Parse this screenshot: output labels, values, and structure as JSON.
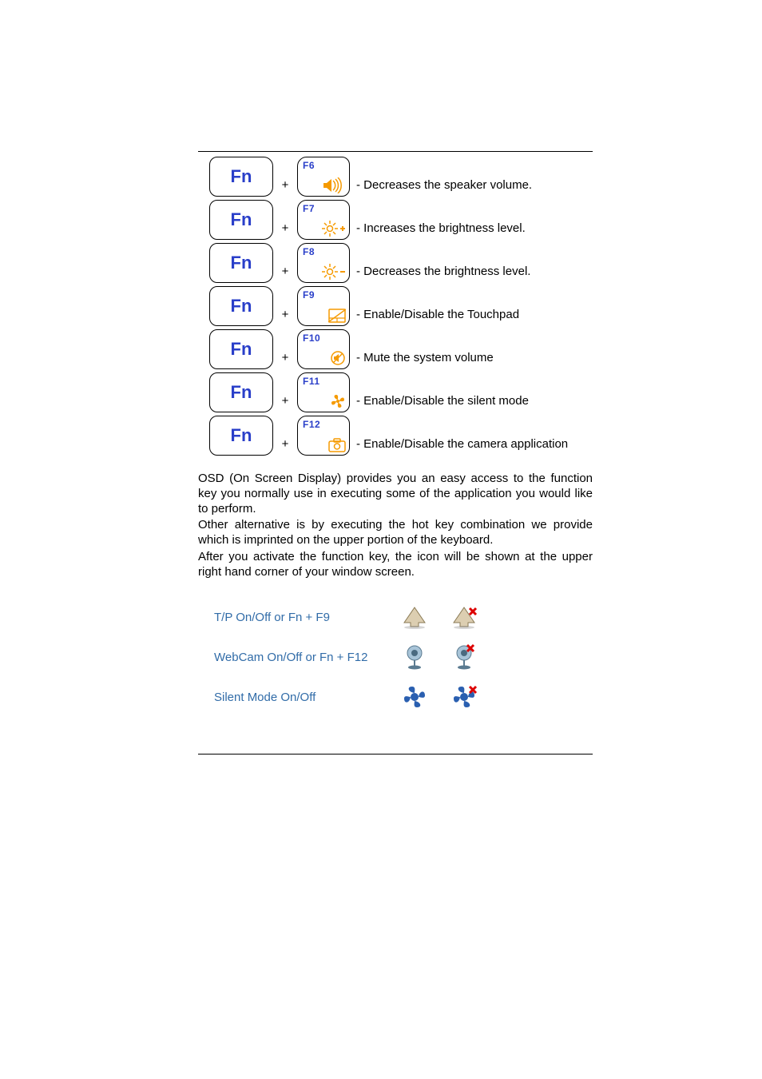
{
  "keys": {
    "fn_label": "Fn",
    "rows": [
      {
        "fkey": "F6",
        "icon": "volume-down-icon",
        "desc": "- Decreases the speaker volume."
      },
      {
        "fkey": "F7",
        "icon": "brightness-up-icon",
        "desc": "- Increases the brightness level."
      },
      {
        "fkey": "F8",
        "icon": "brightness-down-icon",
        "desc": "- Decreases the brightness level."
      },
      {
        "fkey": "F9",
        "icon": "touchpad-icon",
        "desc": "- Enable/Disable the Touchpad"
      },
      {
        "fkey": "F10",
        "icon": "mute-icon",
        "desc": "- Mute the system volume"
      },
      {
        "fkey": "F11",
        "icon": "fan-icon",
        "desc": "- Enable/Disable the silent mode"
      },
      {
        "fkey": "F12",
        "icon": "camera-icon",
        "desc": "- Enable/Disable the camera application"
      }
    ],
    "plus": "+"
  },
  "paragraphs": {
    "p1": "OSD (On Screen Display) provides you an easy access to the function key you normally use in executing some of the application you would like to perform.",
    "p2": "Other alternative is by executing the hot key combination we provide which is imprinted on the upper portion of the keyboard.",
    "p3": "After you activate the function key, the icon will be shown at the upper right hand corner of your window screen."
  },
  "osd": {
    "rows": [
      {
        "label": "T/P  On/Off or Fn + F9",
        "icon_on": "touchpad-on-osd-icon",
        "icon_off": "touchpad-off-osd-icon"
      },
      {
        "label": "WebCam On/Off or Fn + F12",
        "icon_on": "webcam-on-osd-icon",
        "icon_off": "webcam-off-osd-icon"
      },
      {
        "label": "Silent Mode On/Off",
        "icon_on": "silent-on-osd-icon",
        "icon_off": "silent-off-osd-icon"
      }
    ]
  }
}
